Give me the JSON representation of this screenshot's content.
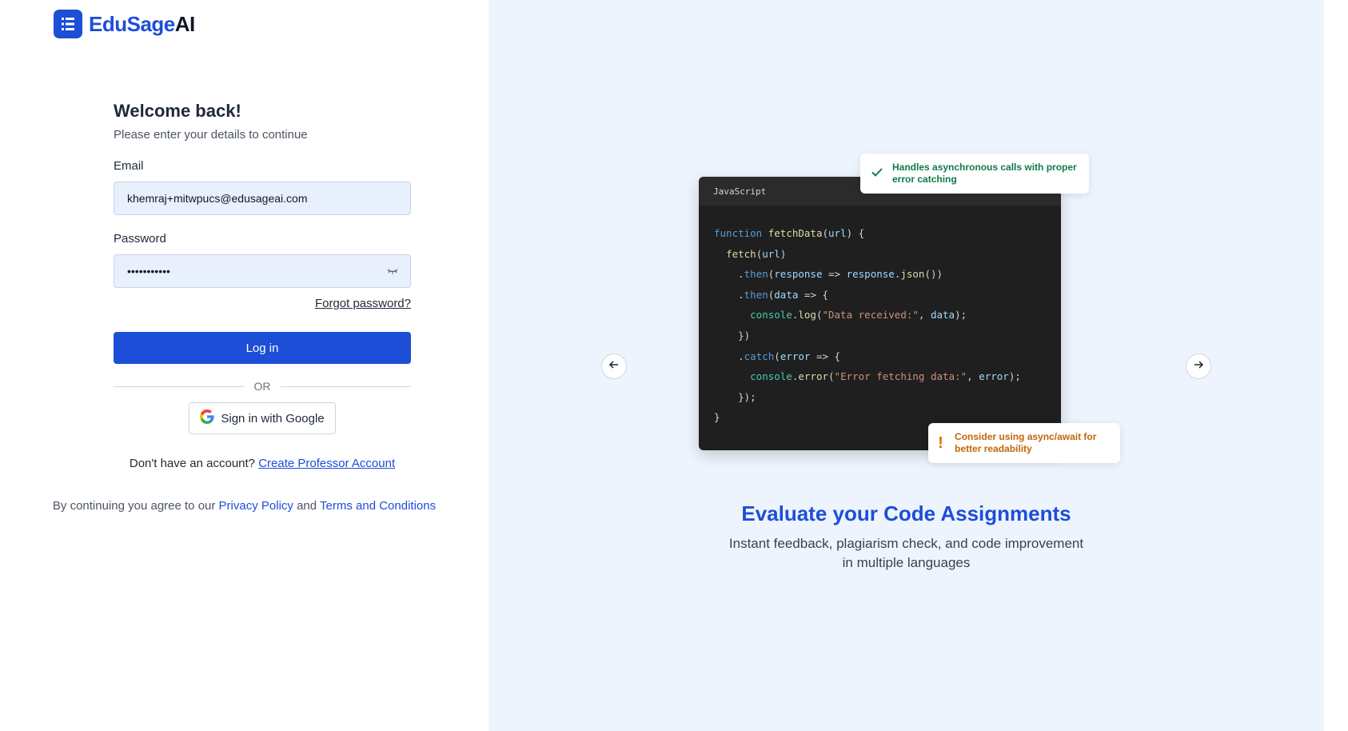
{
  "brand": {
    "name_part1": "EduSage",
    "name_part2": "AI"
  },
  "login": {
    "title": "Welcome back!",
    "subtitle": "Please enter your details to continue",
    "email_label": "Email",
    "email_value": "khemraj+mitwpucs@edusageai.com",
    "password_label": "Password",
    "password_value": "•••••••••••",
    "forgot_link": "Forgot password?",
    "login_button": "Log in",
    "or_text": "OR",
    "google_button": "Sign in with Google",
    "signup_prompt": "Don't have an account?",
    "signup_link": "Create Professor Account"
  },
  "terms": {
    "prefix": "By continuing you agree to our",
    "privacy": "Privacy Policy",
    "and": "and",
    "conditions": "Terms and Conditions"
  },
  "showcase": {
    "code_language": "JavaScript",
    "badge_success": "Handles asynchronous calls with proper error catching",
    "badge_warning": "Consider using async/await for better readability",
    "headline": "Evaluate your Code Assignments",
    "description": "Instant feedback, plagiarism check, and code improvement in multiple languages",
    "icons": {
      "prev": "arrow-left-icon",
      "next": "arrow-right-icon",
      "success": "check-icon",
      "warning": "exclamation-icon",
      "password_toggle": "eye-closed-icon",
      "google": "google-logo-icon",
      "brand": "list-document-icon"
    }
  },
  "colors": {
    "brand_blue": "#1d4ed8",
    "right_bg": "#eef4fd",
    "success": "#0f7a4a",
    "warning": "#d97706",
    "code_bg": "#1f1f1f"
  }
}
